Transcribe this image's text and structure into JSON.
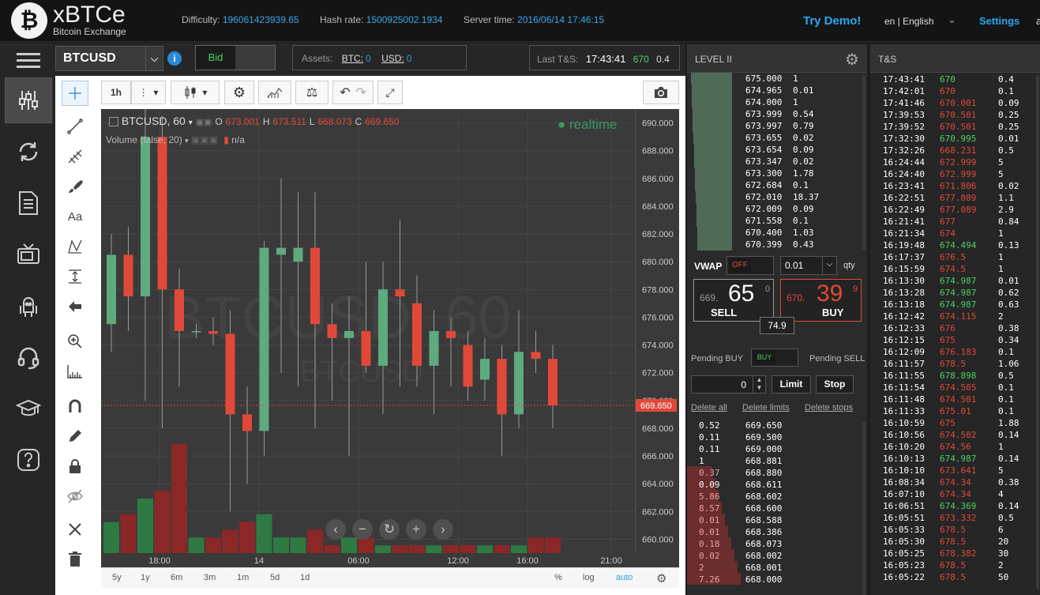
{
  "header": {
    "logo_glyph": "₿",
    "brand": "xBTCe",
    "brand_sub": "Bitcoin Exchange",
    "difficulty_label": "Difficulty:",
    "difficulty": "196061423939.65",
    "hashrate_label": "Hash rate:",
    "hashrate": "1500925002.1934",
    "servertime_label": "Server time:",
    "servertime": "2016/06/14 17:46:15",
    "try_demo": "Try Demo!",
    "language": "en | English",
    "settings": "Settings",
    "truncated": "a"
  },
  "subbar": {
    "symbol": "BTCUSD",
    "bid_label": "Bid",
    "assets_label": "Assets:",
    "btc_label": "BTC:",
    "btc_value": "0",
    "usd_label": "USD:",
    "usd_value": "0",
    "last_label": "Last T&S:",
    "last_time": "17:43:41",
    "last_price": "670",
    "last_qty": "0.4"
  },
  "chart_toolbar": {
    "interval": "1h"
  },
  "chart_data": {
    "type": "candlestick",
    "symbol_label": "BTCUSD, 60",
    "o_label": "O",
    "open": "673.001",
    "h_label": "H",
    "high": "673.511",
    "l_label": "L",
    "low": "668.073",
    "c_label": "C",
    "close": "669.650",
    "volume_label": "Volume (false, 20)",
    "volume_value": "n/a",
    "realtime_label": "realtime",
    "watermark": "BTCUSD, 60",
    "watermark_sub": "BTCUSD",
    "last_price_tag": "669.650",
    "ylim": [
      659,
      691
    ],
    "yticks": [
      "690.000",
      "688.000",
      "686.000",
      "684.000",
      "682.000",
      "680.000",
      "678.000",
      "676.000",
      "674.000",
      "672.000",
      "670.000",
      "668.000",
      "666.000",
      "664.000",
      "662.000",
      "660.000"
    ],
    "xticks": [
      "18:00",
      "14",
      "06:00",
      "12:00",
      "16:00",
      "21:00"
    ],
    "colors": {
      "up": "#5dab7e",
      "down": "#e0493a"
    },
    "candles": [
      {
        "o": 675.5,
        "h": 682.0,
        "l": 673.5,
        "c": 680.5
      },
      {
        "o": 680.5,
        "h": 682.5,
        "l": 675.0,
        "c": 677.5
      },
      {
        "o": 677.5,
        "h": 691.0,
        "l": 670.0,
        "c": 689.0
      },
      {
        "o": 689.0,
        "h": 690.5,
        "l": 668.0,
        "c": 678.0
      },
      {
        "o": 678.0,
        "h": 679.5,
        "l": 671.0,
        "c": 675.0
      },
      {
        "o": 675.0,
        "h": 675.5,
        "l": 674.5,
        "c": 675.0
      },
      {
        "o": 675.0,
        "h": 676.0,
        "l": 674.0,
        "c": 674.8
      },
      {
        "o": 674.8,
        "h": 676.5,
        "l": 662.0,
        "c": 669.0
      },
      {
        "o": 669.0,
        "h": 671.0,
        "l": 664.0,
        "c": 667.8
      },
      {
        "o": 667.8,
        "h": 681.5,
        "l": 666.0,
        "c": 681.0
      },
      {
        "o": 680.5,
        "h": 686.0,
        "l": 672.0,
        "c": 681.0
      },
      {
        "o": 680.0,
        "h": 685.0,
        "l": 671.0,
        "c": 681.0
      },
      {
        "o": 681.0,
        "h": 685.0,
        "l": 668.0,
        "c": 675.5
      },
      {
        "o": 675.5,
        "h": 677.0,
        "l": 670.0,
        "c": 674.5
      },
      {
        "o": 674.5,
        "h": 677.5,
        "l": 666.0,
        "c": 675.0
      },
      {
        "o": 675.0,
        "h": 680.0,
        "l": 672.0,
        "c": 672.5
      },
      {
        "o": 672.5,
        "h": 680.0,
        "l": 669.0,
        "c": 678.0
      },
      {
        "o": 678.0,
        "h": 683.0,
        "l": 671.0,
        "c": 677.5
      },
      {
        "o": 677.0,
        "h": 679.0,
        "l": 671.0,
        "c": 672.5
      },
      {
        "o": 672.5,
        "h": 676.5,
        "l": 669.0,
        "c": 675.0
      },
      {
        "o": 675.0,
        "h": 676.0,
        "l": 671.0,
        "c": 674.5
      },
      {
        "o": 674.0,
        "h": 675.0,
        "l": 670.0,
        "c": 671.0
      },
      {
        "o": 671.5,
        "h": 674.5,
        "l": 670.0,
        "c": 673.0
      },
      {
        "o": 673.0,
        "h": 674.0,
        "l": 666.0,
        "c": 669.0
      },
      {
        "o": 669.0,
        "h": 676.5,
        "l": 668.0,
        "c": 673.5
      },
      {
        "o": 673.5,
        "h": 675.0,
        "l": 672.0,
        "c": 673.0
      },
      {
        "o": 673.0,
        "h": 674.0,
        "l": 668.0,
        "c": 669.65
      }
    ],
    "volumes": [
      4,
      5,
      7,
      8,
      14,
      2,
      2,
      3,
      4,
      5,
      2,
      2,
      3,
      1,
      2,
      2,
      1,
      1,
      1,
      1,
      1,
      1,
      1,
      1,
      1,
      2,
      2
    ],
    "timeframes": [
      "5y",
      "1y",
      "6m",
      "3m",
      "1m",
      "5d",
      "1d"
    ],
    "scale_options": [
      "%",
      "log",
      "auto"
    ]
  },
  "level2": {
    "title": "LEVEL II",
    "asks": [
      [
        "675.000",
        "1"
      ],
      [
        "674.965",
        "0.01"
      ],
      [
        "674.000",
        "1"
      ],
      [
        "673.999",
        "0.54"
      ],
      [
        "673.997",
        "0.79"
      ],
      [
        "673.655",
        "0.02"
      ],
      [
        "673.654",
        "0.09"
      ],
      [
        "673.347",
        "0.02"
      ],
      [
        "673.300",
        "1.78"
      ],
      [
        "672.684",
        "0.1"
      ],
      [
        "672.010",
        "18.37"
      ],
      [
        "672.009",
        "0.09"
      ],
      [
        "671.558",
        "0.1"
      ],
      [
        "670.400",
        "1.03"
      ],
      [
        "670.399",
        "0.43"
      ]
    ],
    "vwap_label": "VWAP",
    "vwap_toggle": "OFF",
    "qty_value": "0.01",
    "qty_label": "qty",
    "sell_prefix": "669.",
    "sell_big": "65",
    "sell_sup": "0",
    "sell_label": "SELL",
    "buy_prefix": "670.",
    "buy_big": "39",
    "buy_sup": "9",
    "buy_label": "BUY",
    "spread": "74.9",
    "pending_buy": "Pending BUY",
    "buy_toggle": "BUY",
    "pending_sell": "Pending SELL",
    "order_qty": "0",
    "limit_label": "Limit",
    "stop_label": "Stop",
    "delete_all": "Delete all",
    "delete_limits": "Delete limits",
    "delete_stops": "Delete stops",
    "bids": [
      [
        "0.52",
        "669.650"
      ],
      [
        "0.11",
        "669.500"
      ],
      [
        "0.11",
        "669.000"
      ],
      [
        "1",
        "668.881"
      ],
      [
        "0.37",
        "668.880"
      ],
      [
        "0.09",
        "668.611"
      ],
      [
        "5.86",
        "668.602"
      ],
      [
        "8.57",
        "668.600"
      ],
      [
        "0.01",
        "668.588"
      ],
      [
        "0.01",
        "668.386"
      ],
      [
        "0.18",
        "668.073"
      ],
      [
        "0.02",
        "668.002"
      ],
      [
        "2",
        "668.001"
      ],
      [
        "7.26",
        "668.000"
      ]
    ]
  },
  "timesales": {
    "title": "T&S",
    "rows": [
      [
        "17:43:41",
        "670",
        "0.4",
        "up"
      ],
      [
        "17:42:01",
        "670",
        "0.1",
        "down"
      ],
      [
        "17:41:46",
        "670.001",
        "0.09",
        "down"
      ],
      [
        "17:39:53",
        "670.501",
        "0.25",
        "down"
      ],
      [
        "17:39:52",
        "670.501",
        "0.25",
        "down"
      ],
      [
        "17:32:30",
        "670.995",
        "0.01",
        "up"
      ],
      [
        "17:32:26",
        "668.231",
        "0.5",
        "down"
      ],
      [
        "16:24:44",
        "672.999",
        "5",
        "down"
      ],
      [
        "16:24:40",
        "672.999",
        "5",
        "down"
      ],
      [
        "16:23:41",
        "671.806",
        "0.02",
        "down"
      ],
      [
        "16:22:51",
        "677.089",
        "1.1",
        "down"
      ],
      [
        "16:22:49",
        "677.089",
        "2.9",
        "down"
      ],
      [
        "16:21:41",
        "677",
        "0.84",
        "down"
      ],
      [
        "16:21:34",
        "674",
        "1",
        "down"
      ],
      [
        "16:19:48",
        "674.494",
        "0.13",
        "up"
      ],
      [
        "16:17:37",
        "676.5",
        "1",
        "down"
      ],
      [
        "16:15:59",
        "674.5",
        "1",
        "down"
      ],
      [
        "16:13:30",
        "674.987",
        "0.01",
        "up"
      ],
      [
        "16:13:28",
        "674.987",
        "0.62",
        "up"
      ],
      [
        "16:13:18",
        "674.987",
        "0.63",
        "up"
      ],
      [
        "16:12:42",
        "674.115",
        "2",
        "down"
      ],
      [
        "16:12:33",
        "676",
        "0.38",
        "down"
      ],
      [
        "16:12:15",
        "675",
        "0.34",
        "down"
      ],
      [
        "16:12:09",
        "676.183",
        "0.1",
        "down"
      ],
      [
        "16:11:57",
        "678.5",
        "1.06",
        "down"
      ],
      [
        "16:11:55",
        "678.898",
        "0.5",
        "up"
      ],
      [
        "16:11:54",
        "674.505",
        "0.1",
        "down"
      ],
      [
        "16:11:48",
        "674.501",
        "0.1",
        "down"
      ],
      [
        "16:11:33",
        "675.01",
        "0.1",
        "down"
      ],
      [
        "16:10:59",
        "675",
        "1.88",
        "down"
      ],
      [
        "16:10:56",
        "674.502",
        "0.14",
        "down"
      ],
      [
        "16:10:20",
        "674.56",
        "1",
        "down"
      ],
      [
        "16:10:13",
        "674.987",
        "0.14",
        "up"
      ],
      [
        "16:10:10",
        "673.641",
        "5",
        "down"
      ],
      [
        "16:08:34",
        "674.34",
        "0.38",
        "down"
      ],
      [
        "16:07:10",
        "674.34",
        "4",
        "down"
      ],
      [
        "16:06:51",
        "674.369",
        "0.14",
        "up"
      ],
      [
        "16:05:51",
        "673.332",
        "0.5",
        "down"
      ],
      [
        "16:05:33",
        "678.5",
        "6",
        "down"
      ],
      [
        "16:05:30",
        "678.5",
        "20",
        "down"
      ],
      [
        "16:05:25",
        "678.382",
        "30",
        "down"
      ],
      [
        "16:05:23",
        "678.5",
        "2",
        "down"
      ],
      [
        "16:05:22",
        "678.5",
        "50",
        "down"
      ]
    ]
  },
  "colors": {
    "accent": "#29a8ef",
    "up": "#4cd163",
    "down": "#e0493a"
  }
}
